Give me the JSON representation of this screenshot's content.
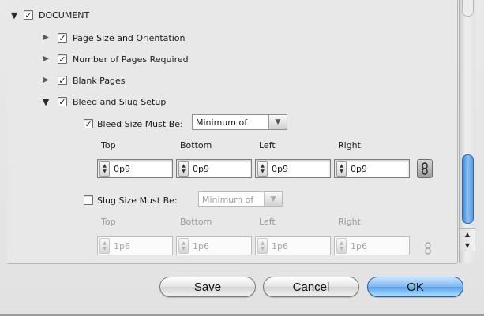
{
  "tree": {
    "document": {
      "label": "DOCUMENT",
      "checked": true
    },
    "items": [
      {
        "label": "Page Size and Orientation",
        "checked": true
      },
      {
        "label": "Number of Pages Required",
        "checked": true
      },
      {
        "label": "Blank Pages",
        "checked": true
      },
      {
        "label": "Bleed and Slug Setup",
        "checked": true
      }
    ]
  },
  "bleed": {
    "label": "Bleed Size Must Be:",
    "checked": true,
    "mode": "Minimum of",
    "columns": [
      "Top",
      "Bottom",
      "Left",
      "Right"
    ],
    "values": [
      "0p9",
      "0p9",
      "0p9",
      "0p9"
    ]
  },
  "slug": {
    "label": "Slug Size Must Be:",
    "checked": false,
    "mode": "Minimum of",
    "columns": [
      "Top",
      "Bottom",
      "Left",
      "Right"
    ],
    "values": [
      "1p6",
      "1p6",
      "1p6",
      "1p6"
    ]
  },
  "buttons": {
    "save": "Save",
    "cancel": "Cancel",
    "ok": "OK"
  },
  "icons": {
    "expanded": "disclosure-triangle-down",
    "collapsed": "disclosure-triangle-right",
    "link": "chain-link-icon"
  },
  "colors": {
    "accent": "#5aa0ec",
    "panel": "#e8e8e8"
  }
}
